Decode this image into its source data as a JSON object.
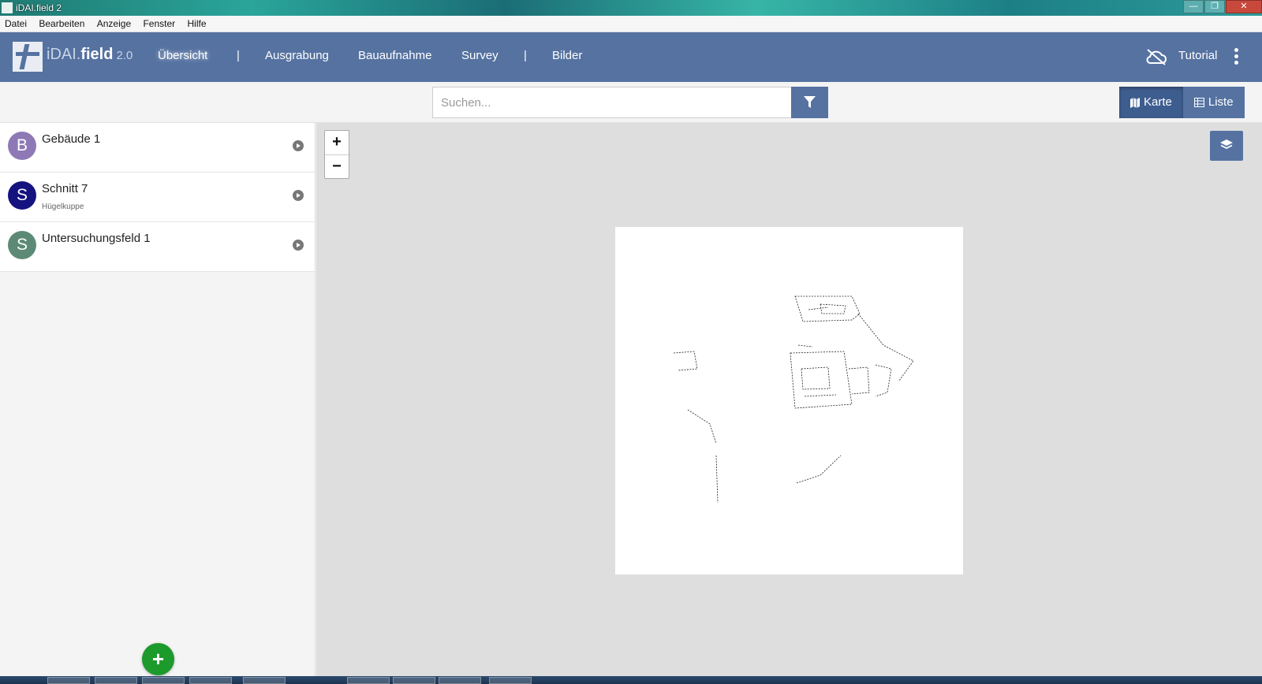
{
  "window": {
    "title": "iDAI.field 2",
    "minimize": "—",
    "maximize": "❐",
    "close": "✕"
  },
  "menu": [
    "Datei",
    "Bearbeiten",
    "Anzeige",
    "Fenster",
    "Hilfe"
  ],
  "navbar": {
    "brand_a": "iDAI.",
    "brand_b": "field",
    "version": "2.0",
    "items": [
      "Übersicht",
      "|",
      "Ausgrabung",
      "Bauaufnahme",
      "Survey",
      "|",
      "Bilder"
    ],
    "active": "Übersicht",
    "tutorial": "Tutorial",
    "icons": {
      "sync": "cloud-off-icon",
      "menu": "kebab-icon"
    }
  },
  "search": {
    "placeholder": "Suchen...",
    "value": ""
  },
  "view_toggle": {
    "map": "Karte",
    "list": "Liste",
    "active": "Karte"
  },
  "list": [
    {
      "letter": "B",
      "title": "Gebäude 1",
      "subtitle": "",
      "color": "#8e79b6"
    },
    {
      "letter": "S",
      "title": "Schnitt 7",
      "subtitle": "Hügelkuppe",
      "color": "#15137f"
    },
    {
      "letter": "S",
      "title": "Untersuchungsfeld 1",
      "subtitle": "",
      "color": "#5c8a76"
    }
  ],
  "add_button": "+",
  "map": {
    "zoom_in": "+",
    "zoom_out": "−",
    "layers_icon": "layers-icon"
  },
  "colors": {
    "primary": "#5572a1",
    "add": "#1c9a2c"
  }
}
